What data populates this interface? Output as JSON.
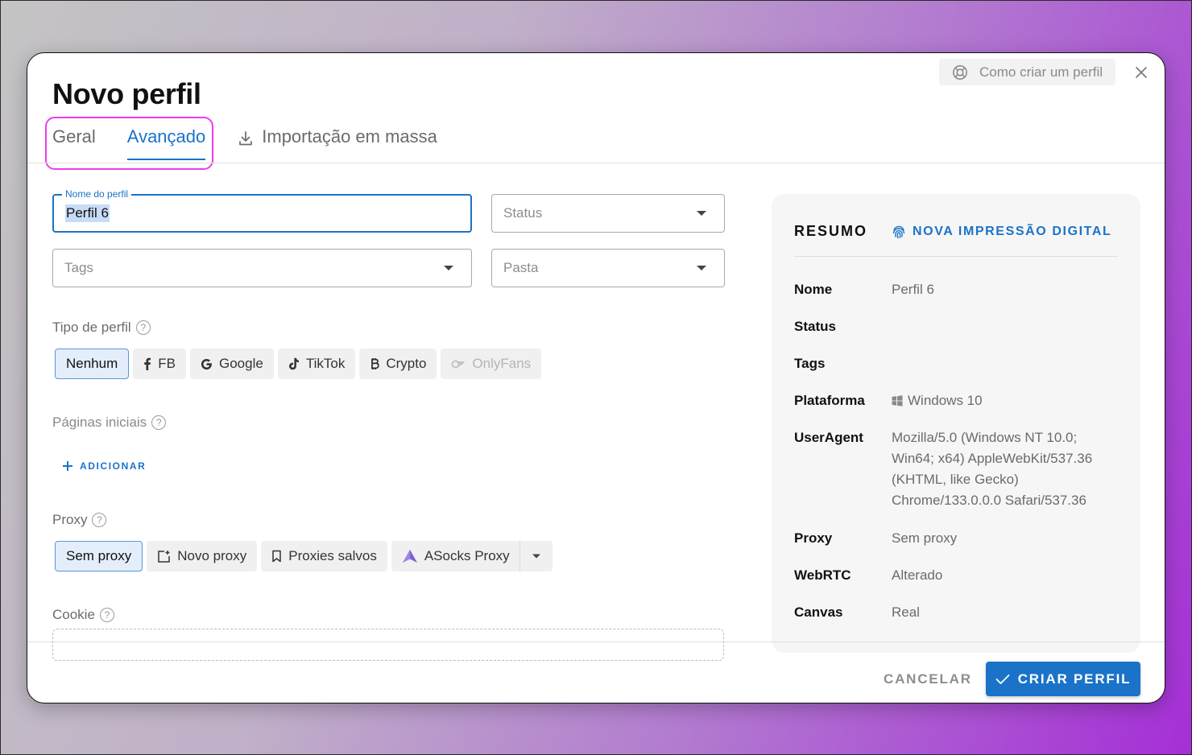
{
  "dialog": {
    "title": "Novo perfil",
    "help_label": "Como criar um perfil"
  },
  "tabs": {
    "geral": "Geral",
    "avancado": "Avançado",
    "import": "Importação em massa",
    "active": "avancado"
  },
  "form": {
    "name_label": "Nome do perfil",
    "name_value": "Perfil 6",
    "status_placeholder": "Status",
    "tags_placeholder": "Tags",
    "folder_placeholder": "Pasta",
    "profile_type_label": "Tipo de perfil",
    "profile_types": [
      "Nenhum",
      "FB",
      "Google",
      "TikTok",
      "Crypto",
      "OnlyFans"
    ],
    "profile_type_selected": "Nenhum",
    "start_pages_label": "Páginas iniciais",
    "add_label": "ADICIONAR",
    "proxy_label": "Proxy",
    "proxy_options": {
      "none": "Sem proxy",
      "new": "Novo proxy",
      "saved": "Proxies salvos",
      "asocks": "ASocks Proxy"
    },
    "proxy_selected": "Sem proxy",
    "cookie_label": "Cookie"
  },
  "summary": {
    "title": "RESUMO",
    "fingerprint_btn": "NOVA IMPRESSÃO DIGITAL",
    "rows": {
      "nome": {
        "key": "Nome",
        "value": "Perfil 6"
      },
      "status": {
        "key": "Status",
        "value": ""
      },
      "tags": {
        "key": "Tags",
        "value": ""
      },
      "plataforma": {
        "key": "Plataforma",
        "value": "Windows 10"
      },
      "useragent": {
        "key": "UserAgent",
        "value": "Mozilla/5.0 (Windows NT 10.0; Win64; x64) AppleWebKit/537.36 (KHTML, like Gecko) Chrome/133.0.0.0 Safari/537.36"
      },
      "proxy": {
        "key": "Proxy",
        "value": "Sem proxy"
      },
      "webrtc": {
        "key": "WebRTC",
        "value": "Alterado"
      },
      "canvas": {
        "key": "Canvas",
        "value": "Real"
      }
    }
  },
  "footer": {
    "cancel": "CANCELAR",
    "create": "CRIAR PERFIL"
  },
  "colors": {
    "accent": "#1a73c9",
    "highlight": "#ee3cea"
  }
}
